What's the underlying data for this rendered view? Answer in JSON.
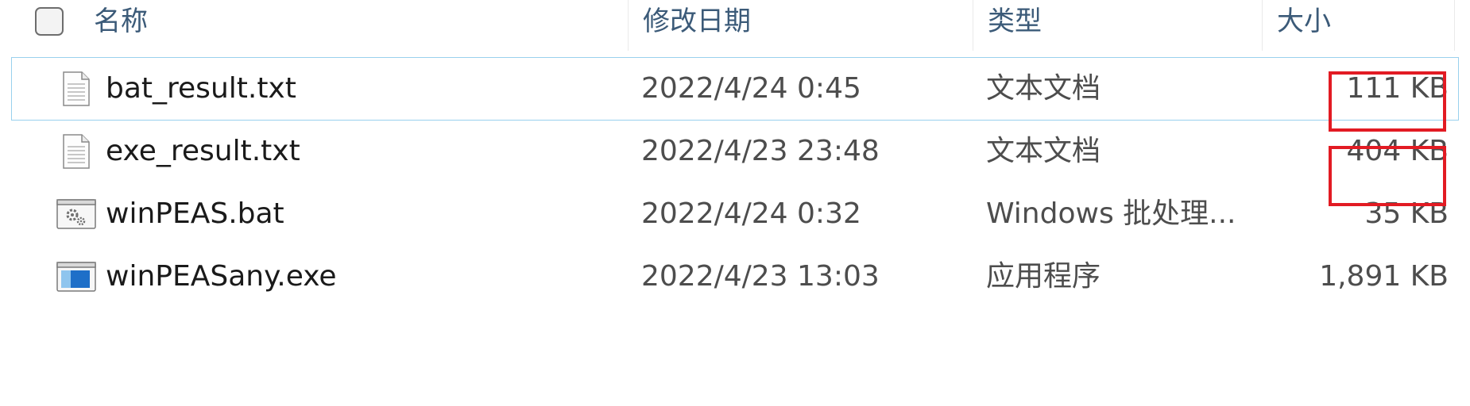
{
  "columns": {
    "name": "名称",
    "date_modified": "修改日期",
    "type": "类型",
    "size": "大小"
  },
  "files": [
    {
      "name": "bat_result.txt",
      "date_modified": "2022/4/24 0:45",
      "type": "文本文档",
      "size": "111 KB",
      "icon": "text-document-icon",
      "selected": true,
      "size_highlighted": true
    },
    {
      "name": "exe_result.txt",
      "date_modified": "2022/4/23 23:48",
      "type": "文本文档",
      "size": "404 KB",
      "icon": "text-document-icon",
      "selected": false,
      "size_highlighted": true
    },
    {
      "name": "winPEAS.bat",
      "date_modified": "2022/4/24 0:32",
      "type": "Windows 批处理...",
      "size": "35 KB",
      "icon": "batch-file-icon",
      "selected": false,
      "size_highlighted": false
    },
    {
      "name": "winPEASany.exe",
      "date_modified": "2022/4/23 13:03",
      "type": "应用程序",
      "size": "1,891 KB",
      "icon": "application-icon",
      "selected": false,
      "size_highlighted": false
    }
  ],
  "colors": {
    "header_text": "#3b5a78",
    "selection_border": "#99d1ee",
    "highlight_box": "#e21b23"
  }
}
